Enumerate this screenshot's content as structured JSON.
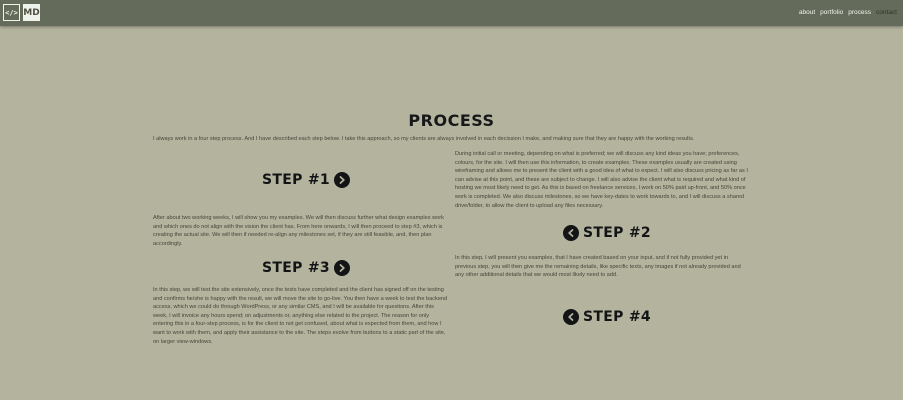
{
  "brand": {
    "code_icon": "code-brackets-icon",
    "initials": "MD"
  },
  "nav": {
    "items": [
      {
        "label": "about"
      },
      {
        "label": "portfolio"
      },
      {
        "label": "process"
      },
      {
        "label": "contact"
      }
    ],
    "active_index": 3
  },
  "process": {
    "title": "PROCESS",
    "intro": "I always work in a four step process. And I have described each step below. I take this approach, so my clients are always involved in each decission I make, and making sure that they are happy with the working results.",
    "steps": [
      {
        "heading": "STEP #1",
        "icon": "chevron-circle-right-icon",
        "text": "During initial call or meeting, depending on what is preferred; we will discuss any kind ideas you have; preferences, colours, for the site. I will then use this information, to create examples. These examples usually are created using wireframing and allows me to present the client with a good idea of what to expect. I will also discuss pricing as far as I can advise at this point, and these are subject to change. I will also advise the client what is required and what kind of hosting we most likely need to get. As this is based on freelance services, I work on 50% paid up-front, and 50% once work is completed. We also discuss milestones, so we have key-dates to work towards to, and I will discuss a shared drive/folder, to allow the client to upload any files necessary."
      },
      {
        "heading": "STEP #2",
        "icon": "chevron-circle-left-icon",
        "text": "After about two working weeks, I will show you my examples. We will then discuss further what design examples work and which ones do not align with the vision the client has. From here onwards, I will then proceed to step #3, which is creating the actual site. We will then if needed re-align any milestones set, if they are still feasible, and, then plan accordingly."
      },
      {
        "heading": "STEP #3",
        "icon": "chevron-circle-right-icon",
        "text": "In this step, I will present you examples, that I have created based on your input, and if not fully provided yet in previous step, you will then give me the remaining details, like specific texts, any images if not already provided and any other additional details that we would most likely need to add."
      },
      {
        "heading": "STEP #4",
        "icon": "chevron-circle-left-icon",
        "text": "In this step, we will test the site extensively, once the tests have completed and the client has signed off on the testing and confirms he/she is happy with the result, we will move the site to go-live. You then have a week to test the backend access, which we could do through WordPress, or any similar CMS, and I will be available for questions. After this week, I will invoice any hours spend; on adjustments or, anything else related to the project. The reason for only entering this in a four-step process, is for the client to not get confused, about what is expected from them, and how I want to work with them, and apply their assistance to the site. The steps evolve from buttons to a static part of the site, on larger view-windows."
      }
    ]
  },
  "colors": {
    "background": "#b4b49e",
    "navbar": "#656b5a",
    "heading": "#121416",
    "body_text": "#44443a"
  }
}
